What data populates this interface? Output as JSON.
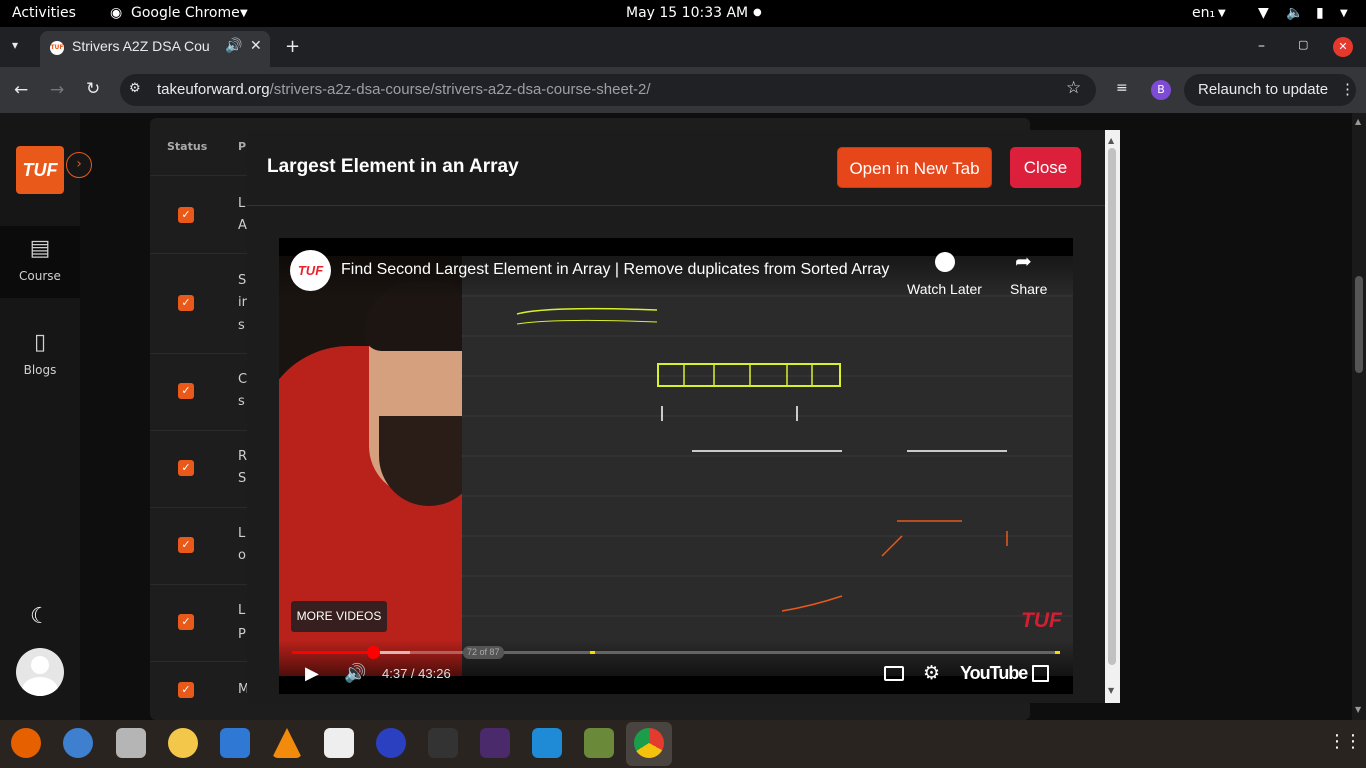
{
  "os": {
    "activities": "Activities",
    "app_menu": "Google Chrome",
    "datetime": "May 15  10:33 AM",
    "input_lang": "en₁"
  },
  "browser": {
    "tab_title": "Strivers A2Z DSA Cou",
    "url_host": "takeuforward.org",
    "url_path": "/strivers-a2z-dsa-course/strivers-a2z-dsa-course-sheet-2/",
    "profile_initial": "B",
    "relaunch_label": "Relaunch to update"
  },
  "sidebar": {
    "logo_text": "TUF",
    "items": [
      {
        "label": "Course",
        "icon": "book-icon"
      },
      {
        "label": "Blogs",
        "icon": "bookmark-icon"
      }
    ]
  },
  "table": {
    "headers": [
      "Status",
      "P"
    ],
    "rows": [
      {
        "lines": [
          "L",
          "A"
        ]
      },
      {
        "lines": [
          "S",
          "ir",
          "s"
        ]
      },
      {
        "lines": [
          "C",
          "s"
        ]
      },
      {
        "lines": [
          "R",
          "S"
        ]
      },
      {
        "lines": [
          "L",
          "o"
        ]
      },
      {
        "lines": [
          "L",
          "P"
        ]
      },
      {
        "lines": [
          "M"
        ]
      }
    ]
  },
  "modal": {
    "title": "Largest Element in an Array",
    "open_new_tab": "Open in New Tab",
    "close": "Close"
  },
  "video": {
    "channel_logo": "TUF",
    "title": "Find Second Largest Element in Array | Remove duplicates from Sorted Array",
    "watch_later": "Watch Later",
    "share": "Share",
    "more_videos": "MORE VIDEOS",
    "current_time": "4:37",
    "duration": "43:26",
    "progress_fraction": 0.106,
    "chapter_tag": "72 of 87",
    "brand": "YouTube",
    "watermark": "TUF"
  },
  "colors": {
    "accent_orange": "#e5461a",
    "close_red": "#dc1f3b",
    "progress_red": "#ff0000"
  }
}
